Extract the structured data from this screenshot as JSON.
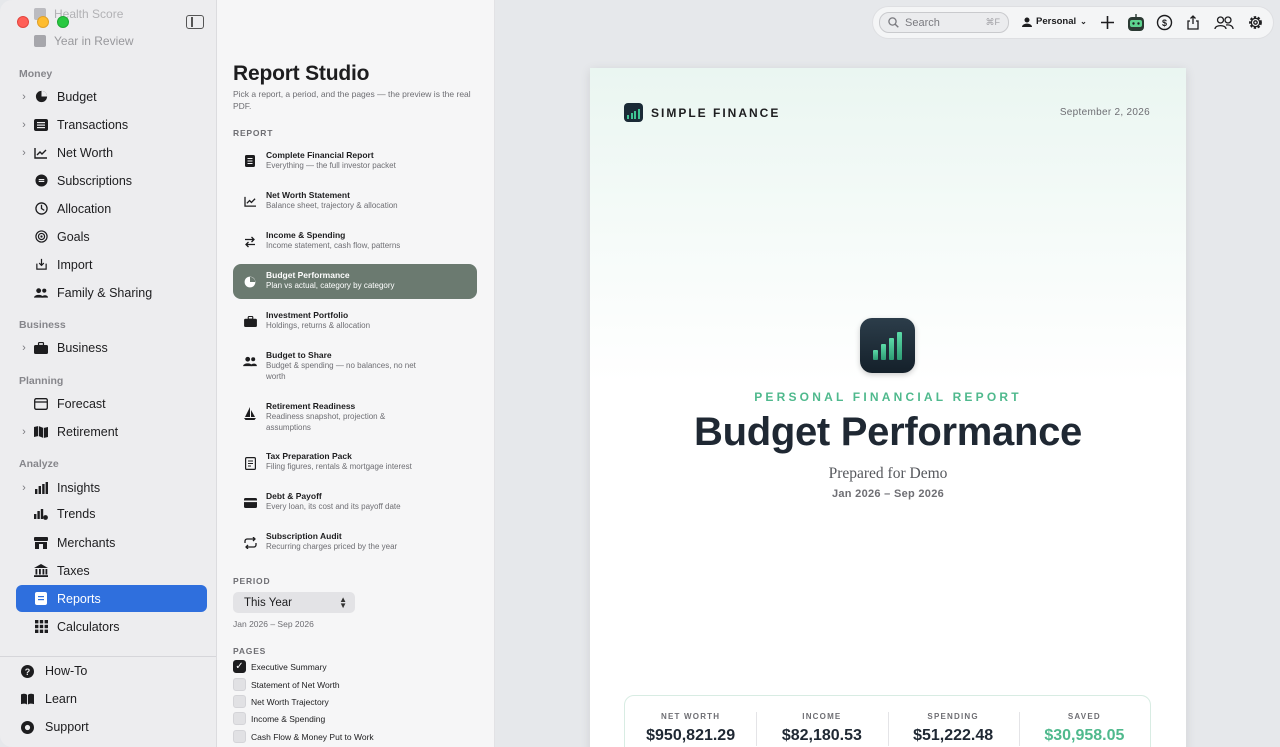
{
  "sidebar": {
    "ghost_items": [
      "Health Score",
      "Year in Review"
    ],
    "sections": {
      "money": "Money",
      "business": "Business",
      "planning": "Planning",
      "analyze": "Analyze"
    },
    "items": {
      "budget": "Budget",
      "transactions": "Transactions",
      "net_worth": "Net Worth",
      "subscriptions": "Subscriptions",
      "allocation": "Allocation",
      "goals": "Goals",
      "import": "Import",
      "family": "Family & Sharing",
      "business": "Business",
      "forecast": "Forecast",
      "retirement": "Retirement",
      "insights": "Insights",
      "trends": "Trends",
      "merchants": "Merchants",
      "taxes": "Taxes",
      "reports": "Reports",
      "calculators": "Calculators"
    },
    "bottom": {
      "howto": "How-To",
      "learn": "Learn",
      "support": "Support"
    }
  },
  "studio": {
    "title": "Report Studio",
    "subtitle": "Pick a report, a period, and the pages — the preview is the real PDF.",
    "report_caption": "REPORT",
    "reports": [
      {
        "name": "Complete Financial Report",
        "desc": "Everything — the full investor packet"
      },
      {
        "name": "Net Worth Statement",
        "desc": "Balance sheet, trajectory & allocation"
      },
      {
        "name": "Income & Spending",
        "desc": "Income statement, cash flow, patterns"
      },
      {
        "name": "Budget Performance",
        "desc": "Plan vs actual, category by category"
      },
      {
        "name": "Investment Portfolio",
        "desc": "Holdings, returns & allocation"
      },
      {
        "name": "Budget to Share",
        "desc": "Budget & spending — no balances, no net worth"
      },
      {
        "name": "Retirement Readiness",
        "desc": "Readiness snapshot, projection & assumptions"
      },
      {
        "name": "Tax Preparation Pack",
        "desc": "Filing figures, rentals & mortgage interest"
      },
      {
        "name": "Debt & Payoff",
        "desc": "Every loan, its cost and its payoff date"
      },
      {
        "name": "Subscription Audit",
        "desc": "Recurring charges priced by the year"
      }
    ],
    "period_caption": "PERIOD",
    "period_value": "This Year",
    "period_range": "Jan 2026 – Sep 2026",
    "pages_caption": "PAGES",
    "pages": [
      {
        "label": "Executive Summary",
        "checked": true
      },
      {
        "label": "Statement of Net Worth",
        "checked": false
      },
      {
        "label": "Net Worth Trajectory",
        "checked": false
      },
      {
        "label": "Income & Spending",
        "checked": false
      },
      {
        "label": "Cash Flow & Money Put to Work",
        "checked": false
      }
    ]
  },
  "toolbar": {
    "search_placeholder": "Search",
    "search_shortcut": "⌘F",
    "profile": "Personal"
  },
  "preview": {
    "brand": "SIMPLE FINANCE",
    "date": "September 2, 2026",
    "kicker": "PERSONAL FINANCIAL REPORT",
    "title": "Budget Performance",
    "prepared_for": "Prepared for Demo",
    "range": "Jan 2026 – Sep 2026",
    "stats": [
      {
        "label": "NET WORTH",
        "value": "$950,821.29"
      },
      {
        "label": "INCOME",
        "value": "$82,180.53"
      },
      {
        "label": "SPENDING",
        "value": "$51,222.48"
      },
      {
        "label": "SAVED",
        "value": "$30,958.05"
      }
    ]
  },
  "colors": {
    "accent_blue": "#2f6fdd",
    "active_report": "#6b7a70",
    "brand_green": "#4fb98d"
  }
}
